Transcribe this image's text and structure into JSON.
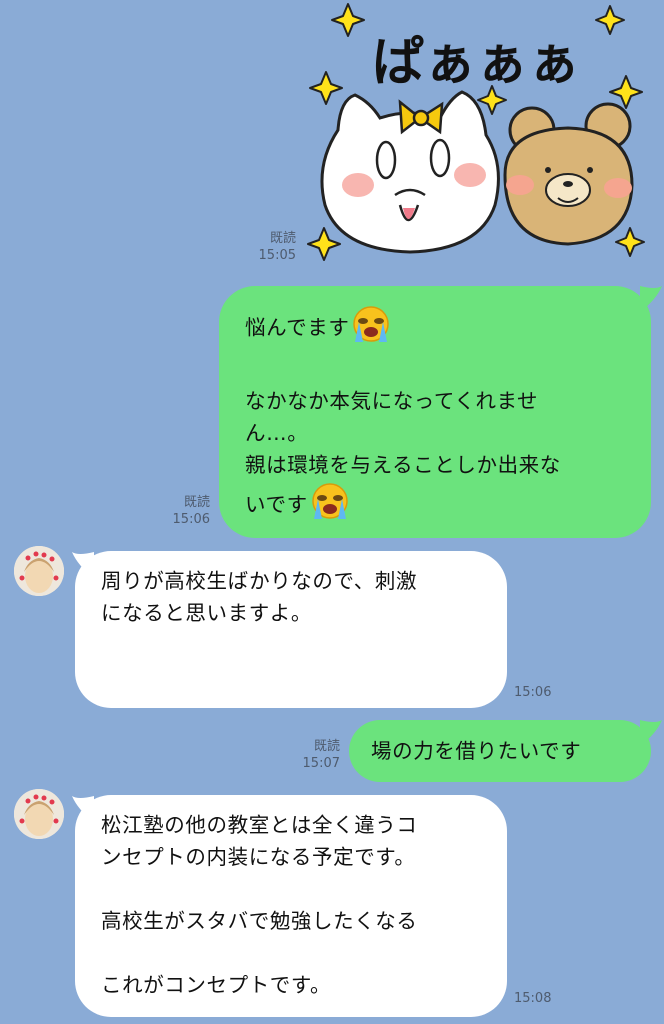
{
  "sticker": {
    "text": "ぱぁぁぁ",
    "read": "既読",
    "time": "15:05"
  },
  "messages": [
    {
      "side": "right",
      "read": "既読",
      "time": "15:06",
      "lines": [
        "悩んでます",
        "",
        "なかなか本気になってくれませ",
        "ん…。",
        "親は環境を与えることしか出来な",
        "いです"
      ],
      "emoji": "loudly-crying-face-icon"
    },
    {
      "side": "left",
      "time": "15:06",
      "lines": [
        "周りが高校生ばかりなので、刺激",
        "になると思いますよ。"
      ]
    },
    {
      "side": "right",
      "read": "既読",
      "time": "15:07",
      "lines": [
        "場の力を借りたいです"
      ]
    },
    {
      "side": "left",
      "time": "15:08",
      "lines": [
        "松江塾の他の教室とは全く違うコ",
        "ンセプトの内装になる予定です。",
        "",
        "高校生がスタバで勉強したくなる",
        "",
        "これがコンセプトです。"
      ]
    }
  ],
  "colors": {
    "background": "#8aabd6",
    "sent_bubble": "#6be37d",
    "received_bubble": "#ffffff"
  }
}
